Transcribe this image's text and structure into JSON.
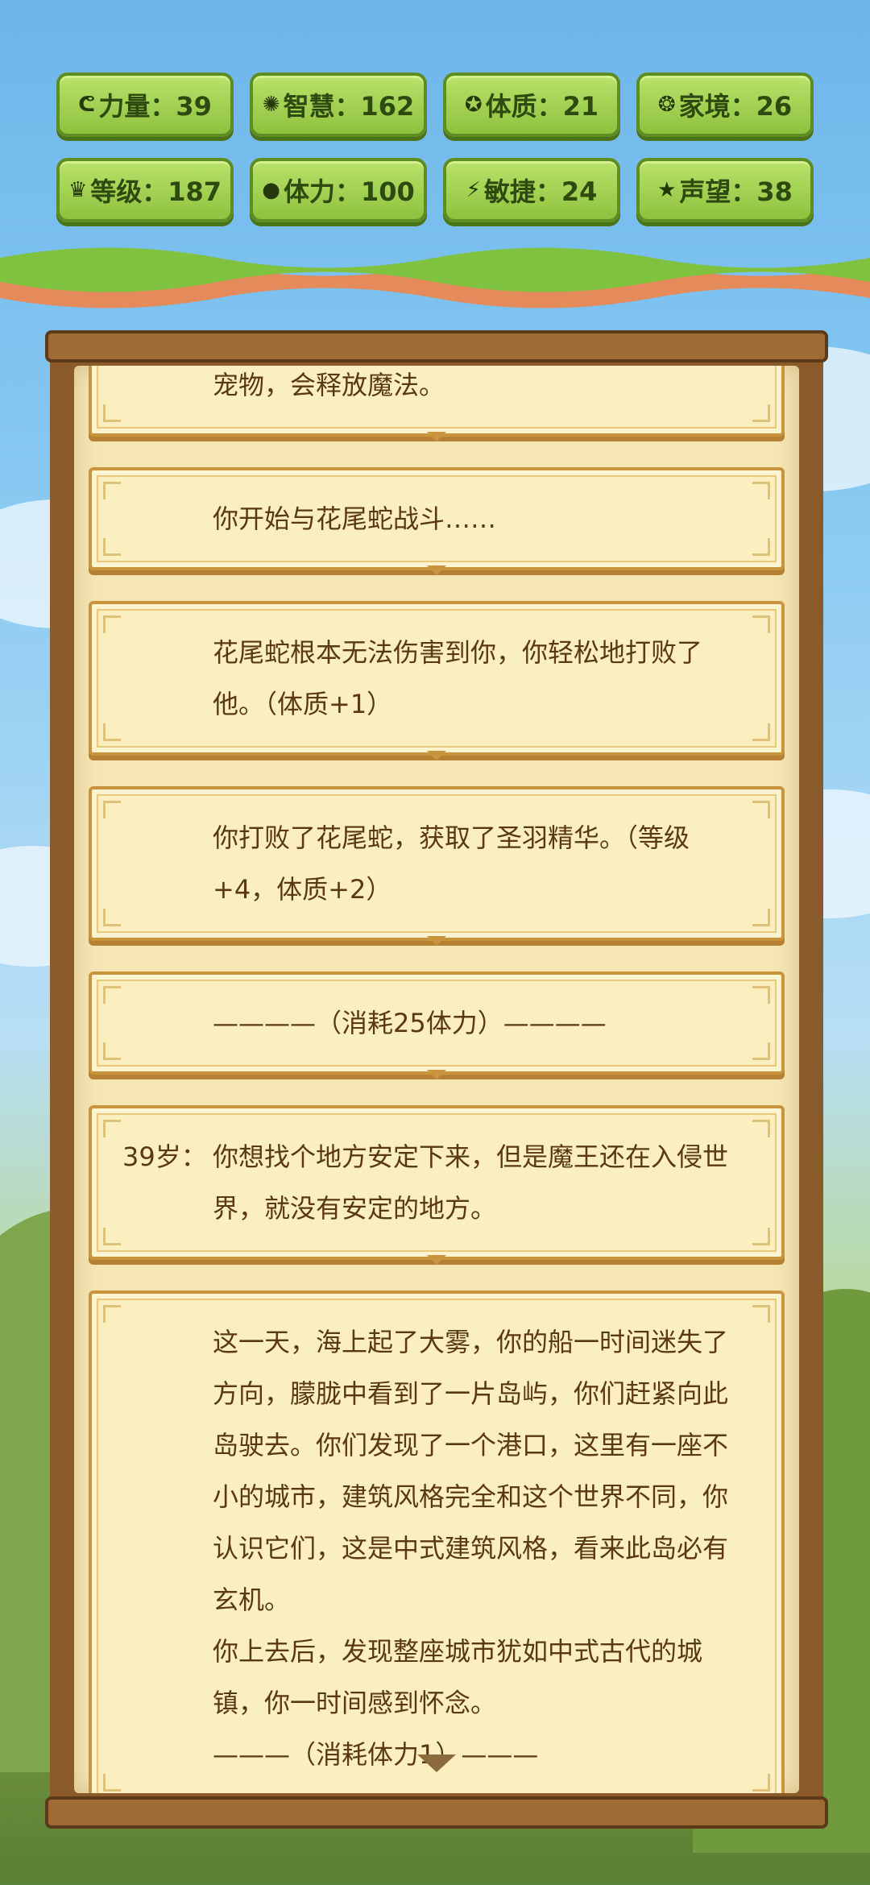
{
  "stats": [
    {
      "icon": "strength-icon",
      "glyph": "ᕦ",
      "label": "力量：39"
    },
    {
      "icon": "wisdom-icon",
      "glyph": "✺",
      "label": "智慧：162"
    },
    {
      "icon": "constitution-icon",
      "glyph": "✪",
      "label": "体质：21"
    },
    {
      "icon": "family-icon",
      "glyph": "❂",
      "label": "家境：26"
    },
    {
      "icon": "crown-icon",
      "glyph": "♛",
      "label": "等级：187"
    },
    {
      "icon": "stamina-icon",
      "glyph": "●",
      "label": "体力：100"
    },
    {
      "icon": "agility-icon",
      "glyph": "⚡",
      "label": "敏捷：24"
    },
    {
      "icon": "star-icon",
      "glyph": "★",
      "label": "声望：38"
    }
  ],
  "log": [
    {
      "age": "",
      "text": "宠物，会释放魔法。"
    },
    {
      "age": "",
      "text": "你开始与花尾蛇战斗……"
    },
    {
      "age": "",
      "text": "花尾蛇根本无法伤害到你，你轻松地打败了他。（体质+1）"
    },
    {
      "age": "",
      "text": "你打败了花尾蛇，获取了圣羽精华。（等级+4，体质+2）"
    },
    {
      "age": "",
      "text": "————（消耗25体力）————"
    },
    {
      "age": "39岁：",
      "text": "你想找个地方安定下来，但是魔王还在入侵世界，就没有安定的地方。"
    },
    {
      "age": "",
      "text": "这一天，海上起了大雾，你的船一时间迷失了方向，朦胧中看到了一片岛屿，你们赶紧向此岛驶去。你们发现了一个港口，这里有一座不小的城市，建筑风格完全和这个世界不同，你认识它们，这是中式建筑风格，看来此岛必有玄机。\n你上去后，发现整座城市犹如中式古代的城镇，你一时间感到怀念。\n———（消耗体力1）———"
    }
  ],
  "colors": {
    "badge": "#9ccf4a",
    "paper": "#f5e6b4",
    "frame": "#8a5a2b",
    "text": "#5a3815"
  }
}
